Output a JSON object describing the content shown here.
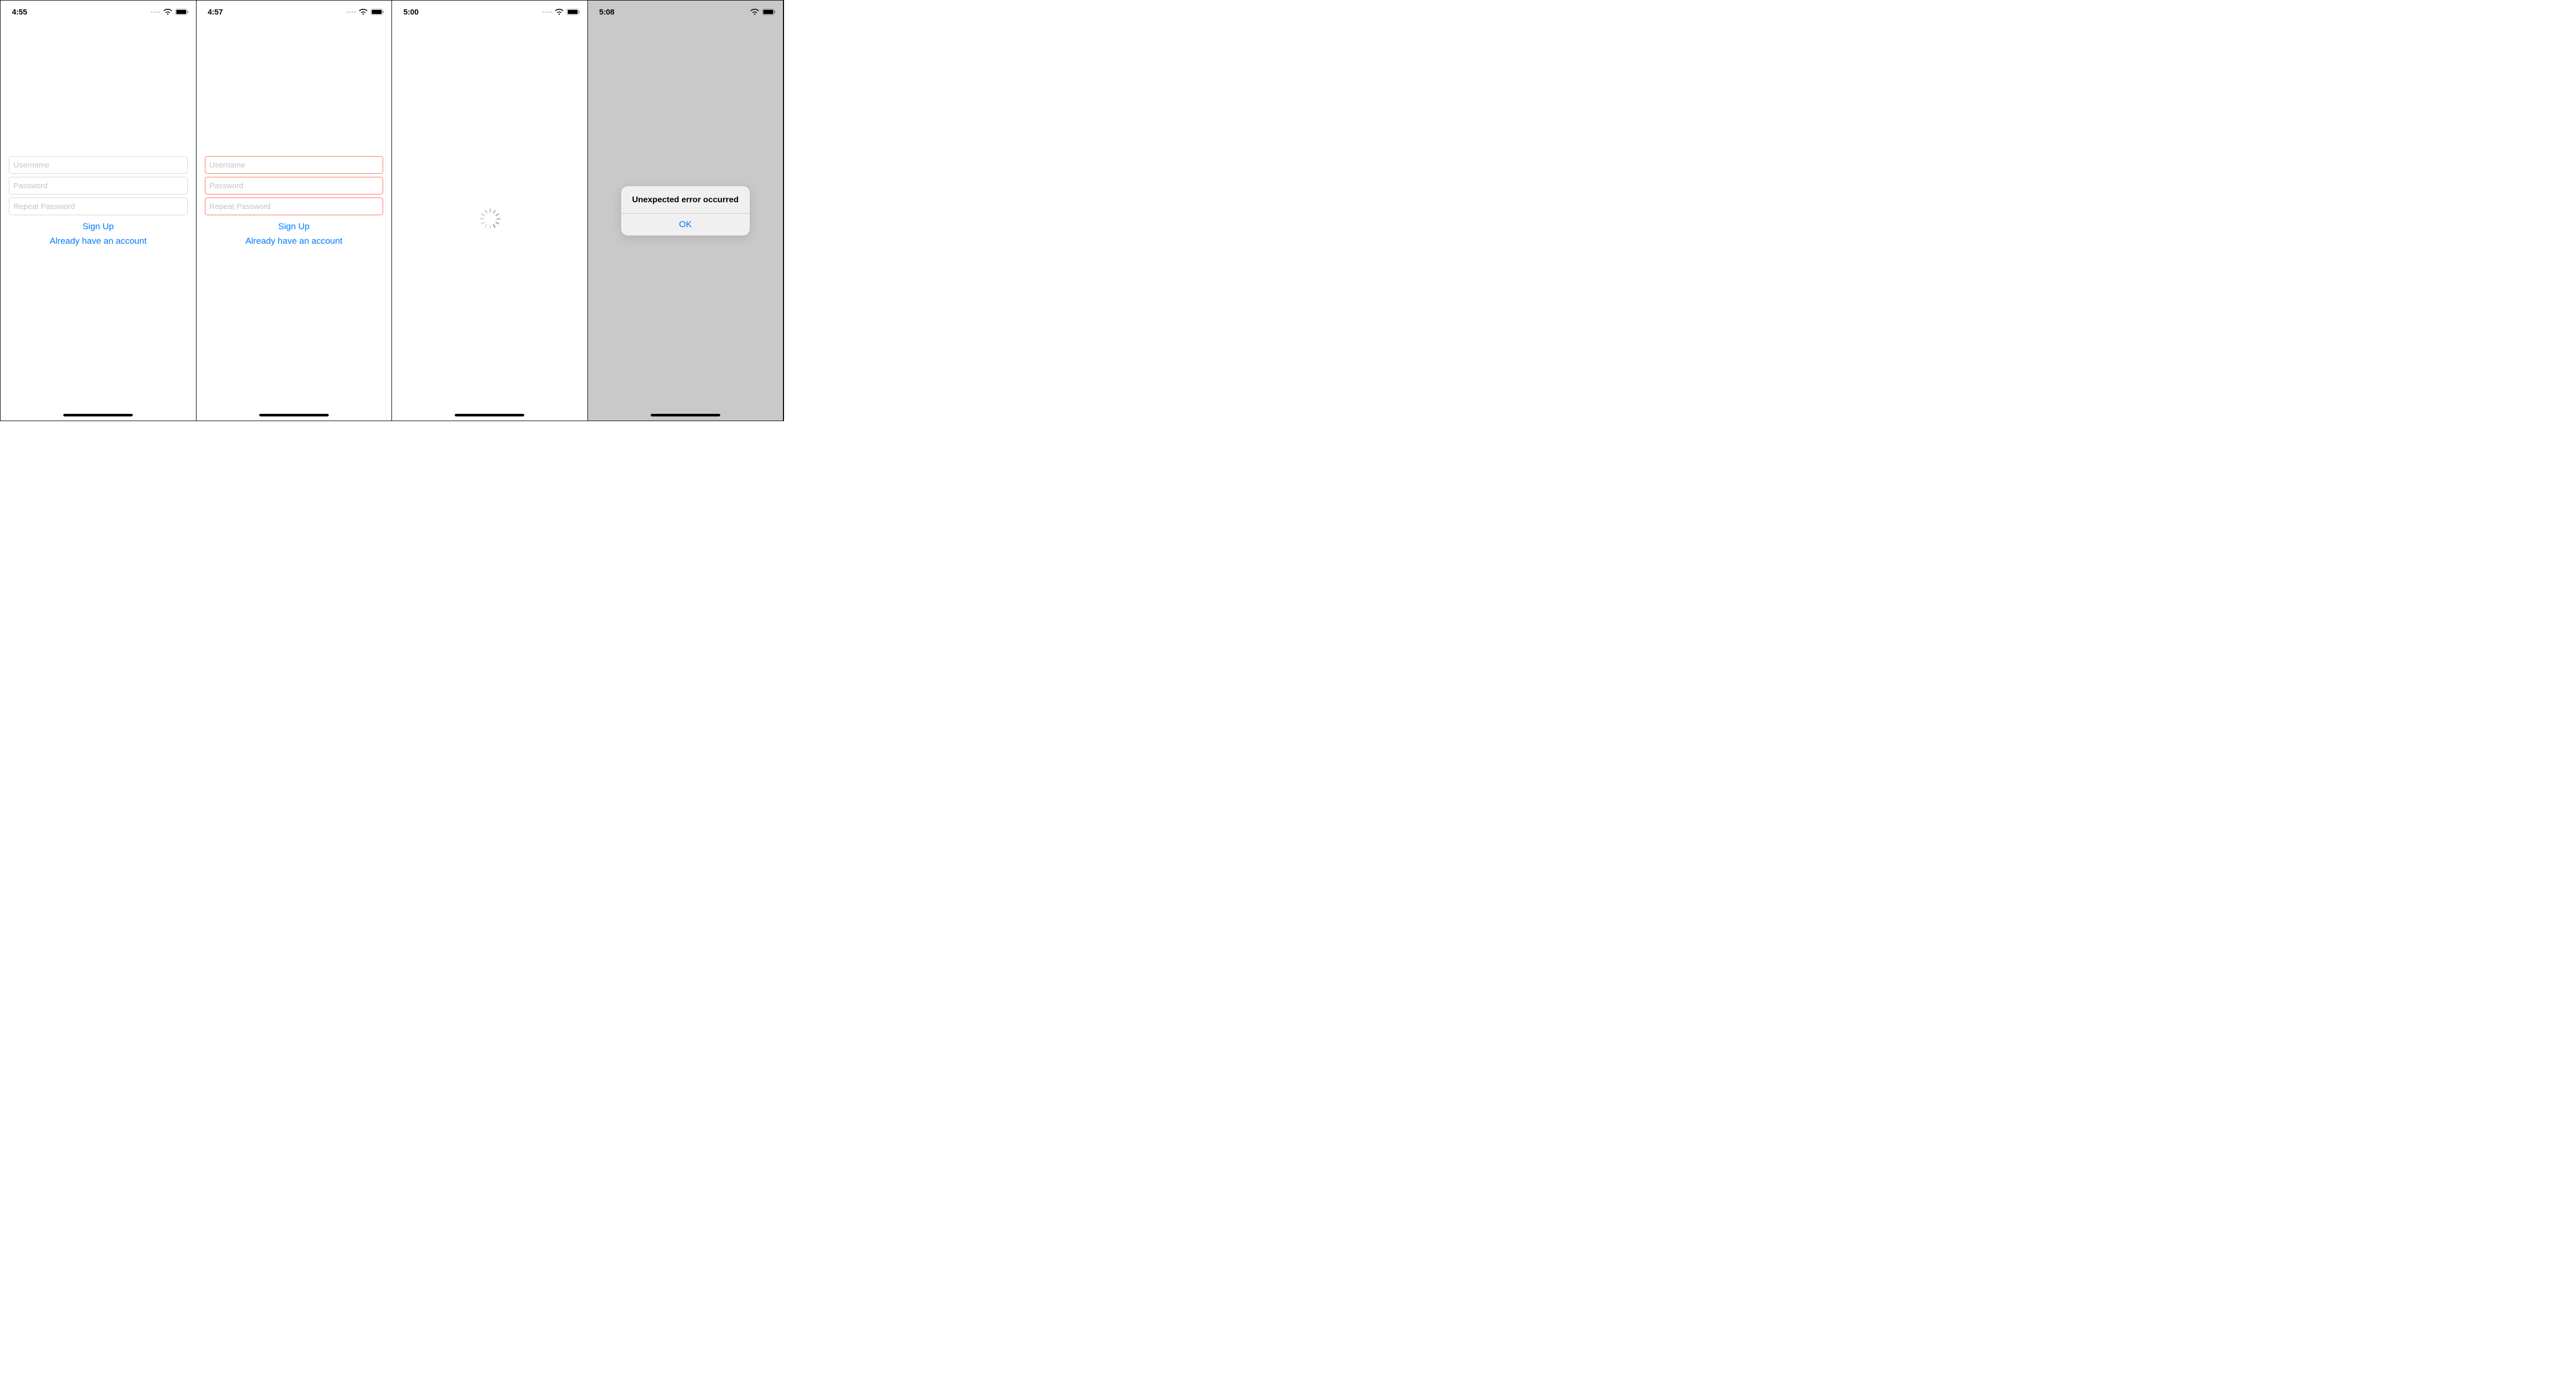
{
  "screens": [
    {
      "time": "4:55",
      "fields": {
        "username_placeholder": "Username",
        "password_placeholder": "Password",
        "repeat_placeholder": "Repeat Password"
      },
      "signup_label": "Sign Up",
      "already_label": "Already have an account"
    },
    {
      "time": "4:57",
      "fields": {
        "username_placeholder": "Username",
        "password_placeholder": "Password",
        "repeat_placeholder": "Repeat Password"
      },
      "signup_label": "Sign Up",
      "already_label": "Already have an account"
    },
    {
      "time": "5:00"
    },
    {
      "time": "5:08",
      "alert": {
        "title": "Unexpected error occurred",
        "ok_label": "OK"
      }
    }
  ]
}
